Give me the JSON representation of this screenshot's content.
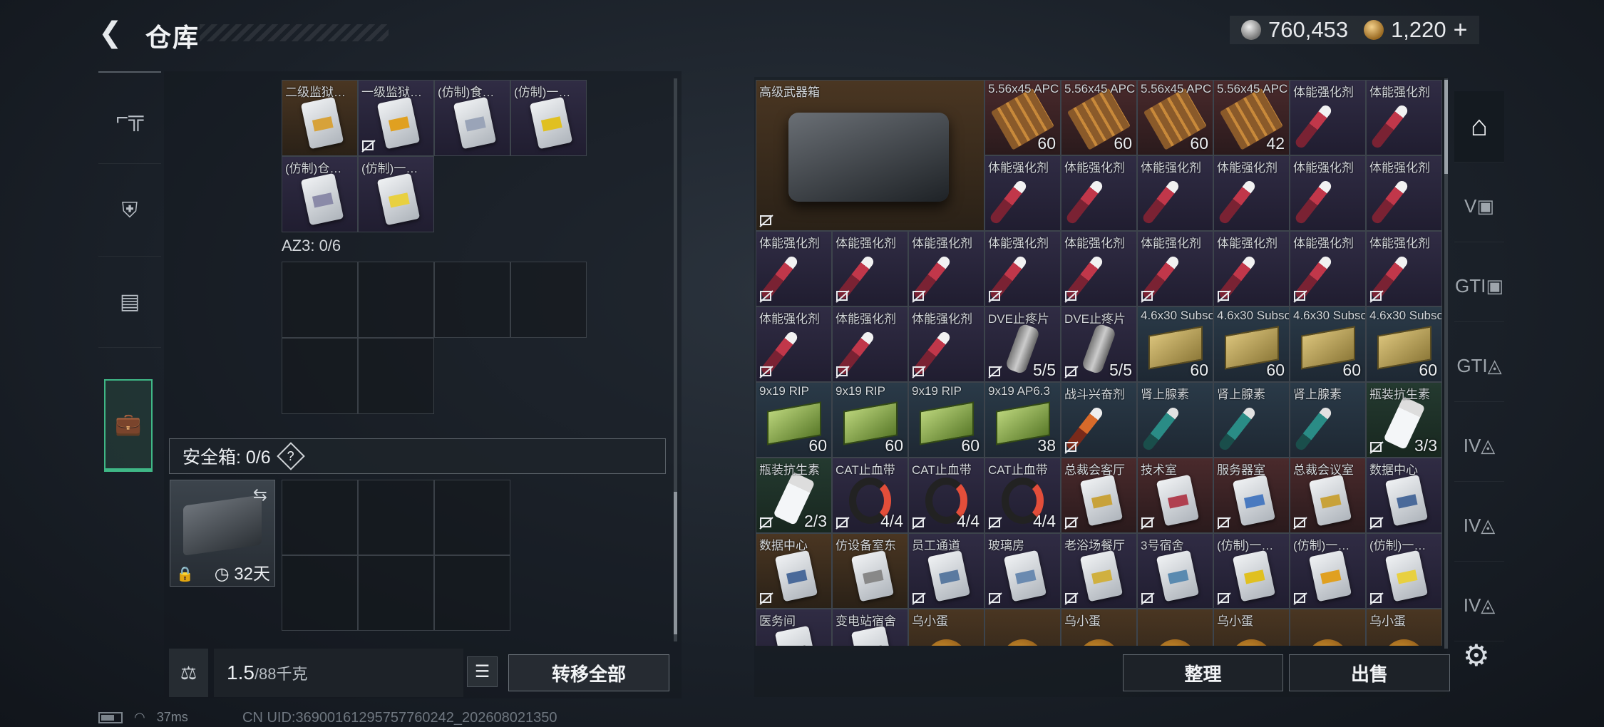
{
  "header": {
    "back_icon": "back-arrow-icon",
    "title": "仓库",
    "currency": {
      "silver_icon": "silver-coin-icon",
      "silver_amount": "760,453",
      "gold_icon": "gold-coin-icon",
      "gold_amount": "1,220",
      "add_label": "+"
    }
  },
  "left_tabs": [
    {
      "icon": "gun-icon",
      "glyph": "⌐╦"
    },
    {
      "icon": "armor-vest-icon",
      "glyph": "⛨"
    },
    {
      "icon": "backpack-icon",
      "glyph": "▤"
    },
    {
      "icon": "briefcase-icon",
      "glyph": "💼",
      "active": true
    }
  ],
  "left_container": {
    "top_items": [
      {
        "label": "二级监狱…",
        "bg": "gold",
        "kind": "card",
        "stripe": "#d7a23a"
      },
      {
        "label": "一级监狱…",
        "bg": "purple",
        "kind": "card",
        "stripe": "#e0a020",
        "nosell": true
      },
      {
        "label": "(仿制)食…",
        "bg": "purple",
        "kind": "card",
        "stripe": "#9aa4b8"
      },
      {
        "label": "(仿制)一…",
        "bg": "purple",
        "kind": "card",
        "stripe": "#e0c020"
      },
      {
        "label": "(仿制)仓…",
        "bg": "purple",
        "kind": "card",
        "stripe": "#8a8aa8"
      },
      {
        "label": "(仿制)一…",
        "bg": "purple",
        "kind": "card",
        "stripe": "#e8d040"
      }
    ],
    "az3_label": "AZ3: 0/6",
    "safe_box": {
      "label": "安全箱: 0/6",
      "help": "?",
      "swap_icon": "swap-icon",
      "lock_icon": "lock-icon",
      "timer_icon": "clock-icon",
      "duration": "32天"
    },
    "weight_icon": "weight-icon",
    "weight_value": "1.5",
    "weight_capacity": "/88千克",
    "list_icon": "list-icon",
    "transfer_all": "转移全部"
  },
  "storage": {
    "crate_label": "高级武器箱",
    "rows": [
      [
        {
          "label": "5.56x45 APC…",
          "bg": "red",
          "kind": "ammo",
          "count": "60"
        },
        {
          "label": "5.56x45 APC…",
          "bg": "red",
          "kind": "ammo",
          "count": "60"
        },
        {
          "label": "5.56x45 APC…",
          "bg": "red",
          "kind": "ammo",
          "count": "60"
        },
        {
          "label": "5.56x45 APC…",
          "bg": "red",
          "kind": "ammo",
          "count": "42"
        },
        {
          "label": "体能强化剂",
          "bg": "purple",
          "kind": "syringe"
        },
        {
          "label": "体能强化剂",
          "bg": "purple",
          "kind": "syringe"
        }
      ],
      [
        {
          "label": "体能强化剂",
          "bg": "purple",
          "kind": "syringe"
        },
        {
          "label": "体能强化剂",
          "bg": "purple",
          "kind": "syringe"
        },
        {
          "label": "体能强化剂",
          "bg": "purple",
          "kind": "syringe"
        },
        {
          "label": "体能强化剂",
          "bg": "purple",
          "kind": "syringe"
        },
        {
          "label": "体能强化剂",
          "bg": "purple",
          "kind": "syringe"
        },
        {
          "label": "体能强化剂",
          "bg": "purple",
          "kind": "syringe"
        }
      ],
      [
        {
          "label": "体能强化剂",
          "bg": "purple",
          "kind": "syringe",
          "nosell": true
        },
        {
          "label": "体能强化剂",
          "bg": "purple",
          "kind": "syringe",
          "nosell": true
        },
        {
          "label": "体能强化剂",
          "bg": "purple",
          "kind": "syringe",
          "nosell": true
        },
        {
          "label": "体能强化剂",
          "bg": "purple",
          "kind": "syringe",
          "nosell": true
        },
        {
          "label": "体能强化剂",
          "bg": "purple",
          "kind": "syringe",
          "nosell": true
        },
        {
          "label": "体能强化剂",
          "bg": "purple",
          "kind": "syringe",
          "nosell": true
        },
        {
          "label": "体能强化剂",
          "bg": "purple",
          "kind": "syringe",
          "nosell": true
        },
        {
          "label": "体能强化剂",
          "bg": "purple",
          "kind": "syringe",
          "nosell": true
        },
        {
          "label": "体能强化剂",
          "bg": "purple",
          "kind": "syringe",
          "nosell": true
        }
      ],
      [
        {
          "label": "体能强化剂",
          "bg": "purple",
          "kind": "syringe",
          "nosell": true
        },
        {
          "label": "体能强化剂",
          "bg": "purple",
          "kind": "syringe",
          "nosell": true
        },
        {
          "label": "体能强化剂",
          "bg": "purple",
          "kind": "syringe",
          "nosell": true
        },
        {
          "label": "DVE止疼片",
          "bg": "purple",
          "kind": "canister",
          "count": "5/5",
          "nosell": true
        },
        {
          "label": "DVE止疼片",
          "bg": "purple",
          "kind": "canister",
          "count": "5/5",
          "nosell": true
        },
        {
          "label": "4.6x30 Subsonic",
          "bg": "blue",
          "kind": "box",
          "count": "60"
        },
        {
          "label": "4.6x30 Subsonic",
          "bg": "blue",
          "kind": "box",
          "count": "60"
        },
        {
          "label": "4.6x30 Subsonic",
          "bg": "blue",
          "kind": "box",
          "count": "60"
        },
        {
          "label": "4.6x30 Subsonic",
          "bg": "blue",
          "kind": "box",
          "count": "60"
        }
      ],
      [
        {
          "label": "9x19 RIP",
          "bg": "blue",
          "kind": "box-green",
          "count": "60"
        },
        {
          "label": "9x19 RIP",
          "bg": "blue",
          "kind": "box-green",
          "count": "60"
        },
        {
          "label": "9x19 RIP",
          "bg": "blue",
          "kind": "box-green",
          "count": "60"
        },
        {
          "label": "9x19 AP6.3",
          "bg": "blue",
          "kind": "box-green",
          "count": "38"
        },
        {
          "label": "战斗兴奋剂",
          "bg": "blue",
          "kind": "syringe-orange",
          "nosell": true
        },
        {
          "label": "肾上腺素",
          "bg": "blue",
          "kind": "syringe-teal"
        },
        {
          "label": "肾上腺素",
          "bg": "blue",
          "kind": "syringe-teal"
        },
        {
          "label": "肾上腺素",
          "bg": "blue",
          "kind": "syringe-teal"
        },
        {
          "label": "瓶装抗生素",
          "bg": "green",
          "kind": "bottle",
          "count": "3/3",
          "nosell": true
        }
      ],
      [
        {
          "label": "瓶装抗生素",
          "bg": "green",
          "kind": "bottle",
          "count": "2/3",
          "nosell": true
        },
        {
          "label": "CAT止血带",
          "bg": "purple",
          "kind": "tourniquet",
          "count": "4/4",
          "nosell": true
        },
        {
          "label": "CAT止血带",
          "bg": "purple",
          "kind": "tourniquet",
          "count": "4/4",
          "nosell": true
        },
        {
          "label": "CAT止血带",
          "bg": "purple",
          "kind": "tourniquet",
          "count": "4/4",
          "nosell": true
        },
        {
          "label": "总裁会客厅",
          "bg": "red",
          "kind": "card",
          "stripe": "#c8a23a",
          "nosell": true
        },
        {
          "label": "技术室",
          "bg": "red",
          "kind": "card",
          "stripe": "#b04050",
          "nosell": true
        },
        {
          "label": "服务器室",
          "bg": "red",
          "kind": "card",
          "stripe": "#4a7ac0",
          "nosell": true
        },
        {
          "label": "总裁会议室",
          "bg": "red",
          "kind": "card",
          "stripe": "#c8a23a",
          "nosell": true
        },
        {
          "label": "数据中心",
          "bg": "purple",
          "kind": "card",
          "stripe": "#4a6a9a",
          "nosell": true
        }
      ],
      [
        {
          "label": "数据中心",
          "bg": "gold",
          "kind": "card",
          "stripe": "#4a6a9a",
          "nosell": true
        },
        {
          "label": "仿设备室东",
          "bg": "gold",
          "kind": "card",
          "stripe": "#888",
          "nosell": false
        },
        {
          "label": "员工通道",
          "bg": "purple",
          "kind": "card",
          "stripe": "#5a7aa0",
          "nosell": true
        },
        {
          "label": "玻璃房",
          "bg": "purple",
          "kind": "card",
          "stripe": "#6a8ab0",
          "nosell": true
        },
        {
          "label": "老浴场餐厅",
          "bg": "purple",
          "kind": "card",
          "stripe": "#d0b040",
          "nosell": true
        },
        {
          "label": "3号宿舍",
          "bg": "purple",
          "kind": "card",
          "stripe": "#5a8ab0",
          "nosell": true
        },
        {
          "label": "(仿制)一…",
          "bg": "purple",
          "kind": "card",
          "stripe": "#e0c020",
          "nosell": true
        },
        {
          "label": "(仿制)一…",
          "bg": "purple",
          "kind": "card",
          "stripe": "#e0a020",
          "nosell": true
        },
        {
          "label": "(仿制)一…",
          "bg": "purple",
          "kind": "card",
          "stripe": "#e8d040",
          "nosell": true
        }
      ],
      [
        {
          "label": "医务间",
          "bg": "purple",
          "kind": "card",
          "stripe": "#777"
        },
        {
          "label": "变电站宿舍",
          "bg": "purple",
          "kind": "card",
          "stripe": "#777"
        },
        {
          "label": "乌小蛋",
          "bg": "gold",
          "kind": "egg"
        },
        {
          "label": "",
          "bg": "gold",
          "kind": "egg"
        },
        {
          "label": "乌小蛋",
          "bg": "gold",
          "kind": "egg"
        },
        {
          "label": "",
          "bg": "gold",
          "kind": "egg"
        },
        {
          "label": "乌小蛋",
          "bg": "gold",
          "kind": "egg"
        },
        {
          "label": "",
          "bg": "gold",
          "kind": "egg"
        },
        {
          "label": "乌小蛋",
          "bg": "gold",
          "kind": "egg"
        }
      ]
    ],
    "sort_label": "整理",
    "sell_label": "出售"
  },
  "right_tabs": [
    {
      "icon": "storage-home-icon",
      "glyph": "⌂",
      "active": true
    },
    {
      "icon": "vehicle-icon",
      "glyph": "V▣"
    },
    {
      "icon": "gti-equipment-icon",
      "glyph": "GTI▣"
    },
    {
      "icon": "gti-armor-icon",
      "glyph": "GTI◬"
    },
    {
      "icon": "tier4-armor-icon-1",
      "glyph": "IV◬"
    },
    {
      "icon": "tier4-armor-icon-2",
      "glyph": "IV◬"
    },
    {
      "icon": "tier4-armor-icon-3",
      "glyph": "IV◬"
    }
  ],
  "settings_icon": "gear-icon",
  "status_bar": {
    "battery_icon": "battery-icon",
    "wifi_icon": "wifi-icon",
    "ping": "37ms",
    "uid": "CN UID:36900161295757760242_202608021350"
  }
}
